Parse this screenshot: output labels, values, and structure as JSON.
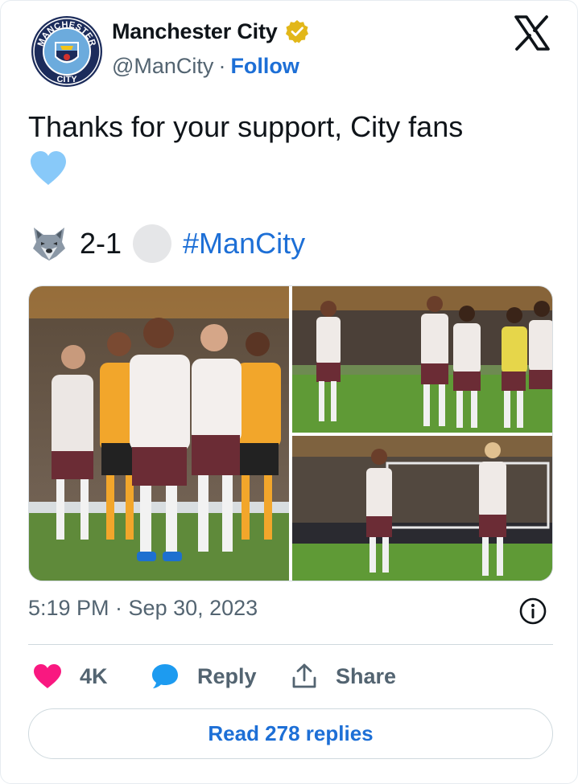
{
  "author": {
    "display_name": "Manchester City",
    "handle": "@ManCity",
    "follow_label": "Follow",
    "verified": true,
    "verified_color": "#e2b719",
    "crest_ring_text": "MANCHESTER",
    "crest_city_text": "CITY"
  },
  "platform_icon": "x-logo-icon",
  "tweet": {
    "line1": "Thanks for your support, City fans",
    "heart_emoji": "light-blue-heart",
    "score": "2-1",
    "hashtag": "#ManCity"
  },
  "media": {
    "photos": [
      {
        "name": "players-applauding-photo"
      },
      {
        "name": "team-line-photo"
      },
      {
        "name": "two-players-applauding-photo"
      }
    ]
  },
  "meta": {
    "timestamp": "5:19 PM · Sep 30, 2023"
  },
  "actions": {
    "like_count": "4K",
    "reply_label": "Reply",
    "share_label": "Share",
    "read_replies_label": "Read 278 replies"
  },
  "colors": {
    "link_blue": "#1d6fd6",
    "like_pink": "#f91880",
    "reply_blue": "#1d9bf0",
    "muted_text": "#536471"
  }
}
